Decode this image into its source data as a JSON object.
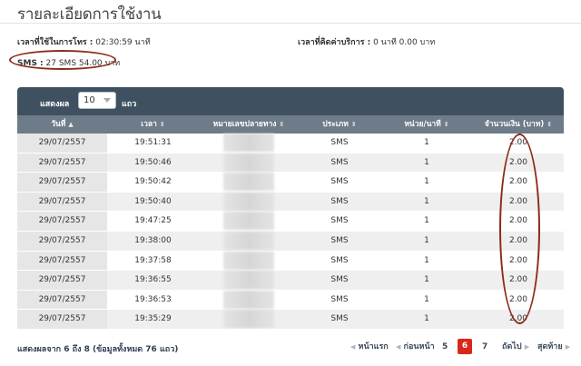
{
  "page": {
    "title": "รายละเอียดการใช้งาน"
  },
  "summary": {
    "call_time_label": "เวลาที่ใช้ในการโทร :",
    "call_time_value": "02:30:59 นาที",
    "charge_time_label": "เวลาที่คิดค่าบริการ :",
    "charge_time_value": "0 นาที  0.00 บาท",
    "sms_label": "SMS :",
    "sms_value": "27 SMS  54.00 บาท"
  },
  "toolbar": {
    "show_label": "แสดงผล",
    "page_size": "10",
    "rows_label": "แถว"
  },
  "table": {
    "headers": [
      "วันที่",
      "เวลา",
      "หมายเลขปลายทาง",
      "ประเภท",
      "หน่วย/นาที",
      "จำนวนเงิน (บาท)"
    ],
    "sort_icons": [
      "▲",
      "⇕",
      "⇕",
      "⇕",
      "⇕",
      "⇕"
    ],
    "rows": [
      {
        "date": "29/07/2557",
        "time": "19:51:31",
        "type": "SMS",
        "units": "1",
        "amount": "2.00"
      },
      {
        "date": "29/07/2557",
        "time": "19:50:46",
        "type": "SMS",
        "units": "1",
        "amount": "2.00"
      },
      {
        "date": "29/07/2557",
        "time": "19:50:42",
        "type": "SMS",
        "units": "1",
        "amount": "2.00"
      },
      {
        "date": "29/07/2557",
        "time": "19:50:40",
        "type": "SMS",
        "units": "1",
        "amount": "2.00"
      },
      {
        "date": "29/07/2557",
        "time": "19:47:25",
        "type": "SMS",
        "units": "1",
        "amount": "2.00"
      },
      {
        "date": "29/07/2557",
        "time": "19:38:00",
        "type": "SMS",
        "units": "1",
        "amount": "2.00"
      },
      {
        "date": "29/07/2557",
        "time": "19:37:58",
        "type": "SMS",
        "units": "1",
        "amount": "2.00"
      },
      {
        "date": "29/07/2557",
        "time": "19:36:55",
        "type": "SMS",
        "units": "1",
        "amount": "2.00"
      },
      {
        "date": "29/07/2557",
        "time": "19:36:53",
        "type": "SMS",
        "units": "1",
        "amount": "2.00"
      },
      {
        "date": "29/07/2557",
        "time": "19:35:29",
        "type": "SMS",
        "units": "1",
        "amount": "2.00"
      }
    ]
  },
  "footer": {
    "info": "แสดงผลจาก 6 ถึง 8 (ข้อมูลทั้งหมด 76 แถว)",
    "first": "หน้าแรก",
    "prev": "ก่อนหน้า",
    "page_5": "5",
    "page_6": "6",
    "page_7": "7",
    "next": "ถัดไป",
    "last": "สุดท้าย"
  },
  "colors": {
    "toolbar": "#3f5060",
    "header": "#6e7b88",
    "active_page": "#d9271b",
    "annotation": "#8e2a1b"
  }
}
